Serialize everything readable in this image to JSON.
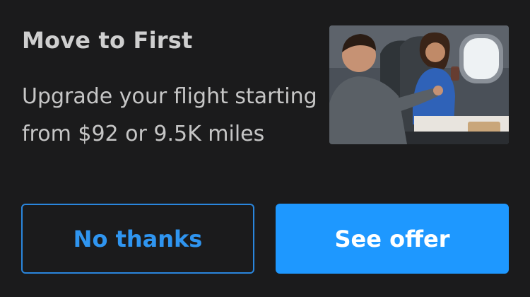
{
  "offer": {
    "title": "Move to First",
    "description": "Upgrade your flight starting from $92 or 9.5K miles",
    "image_icon": "first-class-cabin-photo"
  },
  "actions": {
    "decline_label": "No thanks",
    "accept_label": "See offer"
  },
  "colors": {
    "background": "#1b1b1c",
    "accent": "#1e98ff",
    "secondary_border": "#2a86dd"
  }
}
